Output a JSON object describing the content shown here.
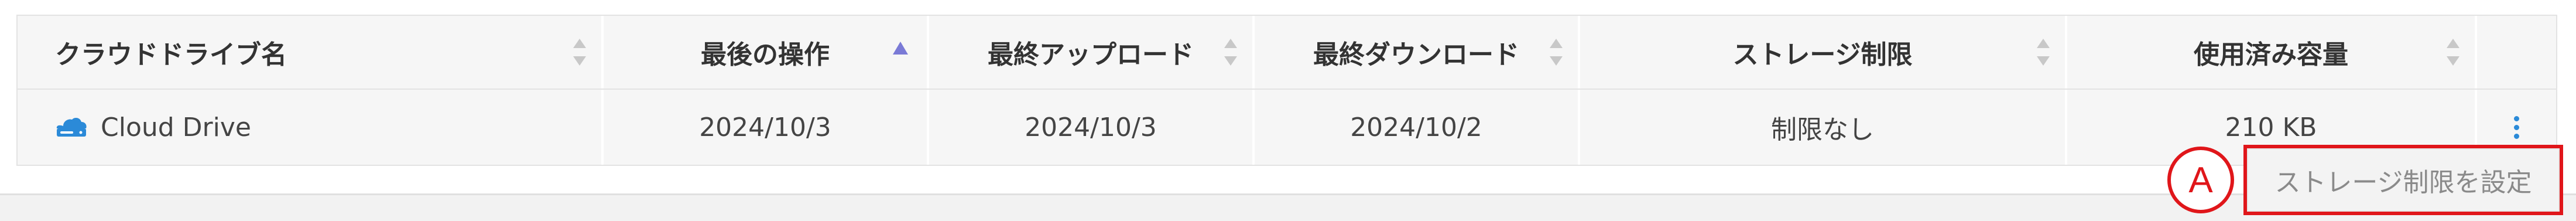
{
  "table": {
    "columns": [
      {
        "label": "クラウドドライブ名"
      },
      {
        "label": "最後の操作"
      },
      {
        "label": "最終アップロード"
      },
      {
        "label": "最終ダウンロード"
      },
      {
        "label": "ストレージ制限"
      },
      {
        "label": "使用済み容量"
      },
      {
        "label": ""
      }
    ],
    "rows": [
      {
        "name": "Cloud Drive",
        "last_action": "2024/10/3",
        "last_upload": "2024/10/3",
        "last_download": "2024/10/2",
        "storage_limit": "制限なし",
        "used": "210 KB"
      }
    ],
    "sort": {
      "column": "最後の操作",
      "direction": "ascending"
    }
  },
  "context_menu": {
    "items": [
      "ストレージ制限を設定"
    ]
  },
  "annotation": {
    "callout_label": "A"
  },
  "colors": {
    "accent": "#2b8ad8",
    "sort_active": "#7a7ad6",
    "highlight": "#e0161a"
  },
  "icons": {
    "drive": "cloud-drive-icon",
    "row_menu": "kebab-menu-icon",
    "sort": "sort-icon"
  }
}
